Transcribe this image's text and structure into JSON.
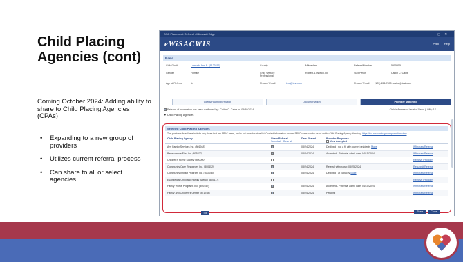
{
  "slide": {
    "title": "Child Placing Agencies (cont)",
    "intro": "Coming October 2024: Adding ability to share to Child Placing Agencies (CPAs)",
    "bullets": [
      "Expanding to a new group of providers",
      "Utilizes current referral process",
      "Can share to all or select agencies"
    ],
    "band_colors": {
      "red": "#a6384c",
      "blue": "#4a6bb7"
    },
    "logo_icon": "heart-logo-icon"
  },
  "window": {
    "titlebar": "DSC Placement Referral - Microsoft Edge",
    "brand": "eWiSACWIS",
    "menu": [
      "Print",
      "Help"
    ]
  },
  "basic": {
    "header": "Basic",
    "child_youth_label": "Child/Youth",
    "child_youth_value": "Lamkah, Ann B. (6123456)",
    "county_label": "County",
    "county_value": "Milwaukee",
    "referral_label": "Referral Number",
    "referral_value": "5555555",
    "gender_label": "Gender",
    "gender_value": "Female",
    "cwp_label": "Child Welfare Professional",
    "cwp_value": "Robert A. Wilson, III",
    "supervisor_label": "Supervisor",
    "supervisor_value": "Caitlin C. Caine",
    "age_label": "Age at Referral",
    "age_value": "14",
    "phone_email_label": "Phone / Email",
    "phone_email_value": "test@test.com",
    "phone_email2_label": "Phone / Email",
    "phone_email2_value": "(123) 456-7890  ccaine@test.com"
  },
  "tabs": [
    "Client/Youth Information",
    "Documentation",
    "Provider Matching"
  ],
  "consent_text": "Release of information has been confirmed by : Caitlin C. Caine on 09/30/2024",
  "assessed_text": "Child's Assessed Level of Need (LON): 1S",
  "cpa_toggle": "Child Placing Agencies",
  "panel": {
    "header": "Selected Child Placing Agencies",
    "note": "The providers listed here include only those that are SPAC users, and is not an exhaustive list. Contact information for non-SPAC users can be found on the Child Placing Agency directory:",
    "note_link": "https://dcf.wisconsin.gov/cwportal/directory",
    "columns": {
      "agency": "Child Placing Agency",
      "share": "Share Referral",
      "select_all": "Select all",
      "clear_all": "Clear all",
      "date": "Date Shared",
      "response": "Provider Response",
      "view_accepted": "View Accepted",
      "action": ""
    },
    "rows": [
      {
        "agency": "Any Family Services Inc. (801948)",
        "shared": true,
        "date": "03/24/2024",
        "response": "Declined - not a fit with current residents",
        "more": "More",
        "action": "Withdraw Referral"
      },
      {
        "agency": "Benevolence First Inc. (805272)",
        "shared": true,
        "date": "03/24/2024",
        "response": "Accepted - Potential admit date: 04/15/2024",
        "more": "",
        "action": "Withdraw Referral"
      },
      {
        "agency": "Children's Home Society (800000)",
        "shared": false,
        "date": "",
        "response": "",
        "more": "",
        "action": "Remove Provider"
      },
      {
        "agency": "Community Care Resources Inc. (800452)",
        "shared": true,
        "date": "03/24/2024",
        "response": "Referral withdrawn: 03/25/2024",
        "more": "",
        "action": "Resubmit Referral"
      },
      {
        "agency": "Community Impact Program Inc. (803648)",
        "shared": true,
        "date": "03/24/2024",
        "response": "Declined - at capacity",
        "more": "More",
        "action": "Withdraw Referral"
      },
      {
        "agency": "Evangelical Child and Family Agency (800477)",
        "shared": false,
        "date": "",
        "response": "",
        "more": "",
        "action": "Remove Provider"
      },
      {
        "agency": "Family Works Programs Inc. (800457)",
        "shared": true,
        "date": "03/24/2024",
        "response": "Accepted - Potential admit date: 04/10/2024",
        "more": "",
        "action": "Withdraw Referral"
      },
      {
        "agency": "Family and Children's Center (871758)",
        "shared": true,
        "date": "03/24/2024",
        "response": "Pending",
        "more": "",
        "action": "Withdraw Referral"
      }
    ]
  },
  "buttons": {
    "top": "Top",
    "share": "Share",
    "close": "Close"
  }
}
